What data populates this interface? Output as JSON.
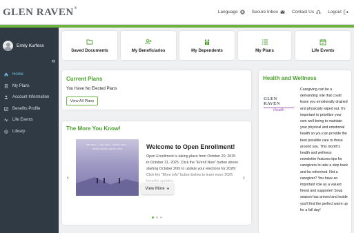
{
  "header": {
    "logo": "GLEN RAVEN",
    "logo_mark": "®",
    "nav": [
      {
        "label": "Language",
        "icon": "globe-icon"
      },
      {
        "label": "Secure Inbox",
        "icon": "envelope-icon"
      },
      {
        "label": "Contact Us",
        "icon": "headset-icon"
      },
      {
        "label": "Logout",
        "icon": "logout-icon"
      }
    ]
  },
  "sidebar": {
    "user_name": "Emily Kurfess",
    "collapse_glyph": "«",
    "items": [
      {
        "label": "Home",
        "icon": "home-icon",
        "active": true
      },
      {
        "label": "My Plans",
        "icon": "document-icon"
      },
      {
        "label": "Account Information",
        "icon": "person-icon"
      },
      {
        "label": "Benefits Profile",
        "icon": "profile-icon"
      },
      {
        "label": "Life Events",
        "icon": "pulse-icon"
      },
      {
        "label": "Library",
        "icon": "book-icon"
      }
    ]
  },
  "tiles": [
    {
      "label": "Saved Documents",
      "icon": "folder-icon"
    },
    {
      "label": "My Beneficiaries",
      "icon": "add-user-icon"
    },
    {
      "label": "My Dependents",
      "icon": "family-icon"
    },
    {
      "label": "My Plans",
      "icon": "list-icon"
    },
    {
      "label": "Life Events",
      "icon": "calendar-icon"
    }
  ],
  "current_plans": {
    "title": "Current Plans",
    "message": "You Have No Elected Plans",
    "button": "View All Plans"
  },
  "more_you_know": {
    "title": "The More You Know!",
    "image_caption": "BE WELL. LIVE WELL. WORK WELL.",
    "image_subcaption": "OPEN ENROLLMENT 2026",
    "heading": "Welcome to Open Enrollment!",
    "body": "Open Enrollment is taking place from October 20, 2025 to October 31, 2025. Click the \"Enroll Now\" button above starting October 20th to update your elections for 2026! Click the \"More info\" button below to learn more 2026 benefits updates.",
    "view_more": "View More",
    "prev_glyph": "‹",
    "next_glyph": "›",
    "active_slide": 1,
    "slide_count": 3
  },
  "health_wellness": {
    "title": "Health and Wellness",
    "logo_text": "GLEN RAVEN",
    "logo_sub": "Health",
    "body": "Caregiving can be a demanding role that could leave you emotionally drained and physically wiped out. It's important to prioritize your own well-being to maintain your physical and emotional health so you can provide the best possible care to those around you. This month's health and wellness newsletter features tips for caregivers to take a step back and be refreshed. Not a caregiver? You have an important role as a valued friend and supporter! Soup season has arrived and inside you'll find the perfect warm up for a fall day!"
  },
  "colors": {
    "accent_green": "#6cb33e",
    "title_green": "#4aa02c",
    "sidebar_bg": "#2f3a45",
    "active_blue": "#6ec1e4"
  }
}
